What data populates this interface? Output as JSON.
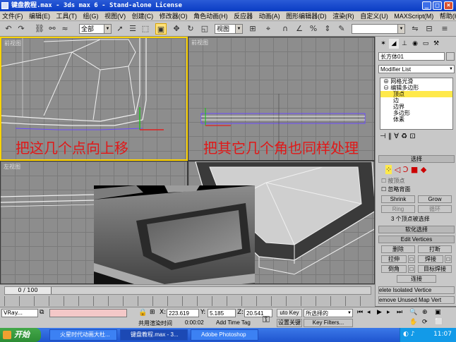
{
  "window": {
    "title": "键盘教程.max - 3ds max 6 - Stand-alone License"
  },
  "menu": [
    "文件(F)",
    "编辑(E)",
    "工具(T)",
    "组(G)",
    "视图(V)",
    "创建(C)",
    "修改器(O)",
    "角色动画(H)",
    "反应器",
    "动画(A)",
    "图形编辑器(D)",
    "渲染(R)",
    "自定义(U)",
    "MAXScript(M)",
    "帮助(H)"
  ],
  "toolbar": {
    "selection_filter": "全部",
    "ref_coord": "视图"
  },
  "viewports": {
    "top_left": {
      "label": "前视图"
    },
    "top_right": {
      "label": "前视图"
    },
    "bottom_left": {
      "label": "左视图"
    },
    "annotation_left": "把这几个点向上移",
    "annotation_right": "把其它几个角也同样处理"
  },
  "cmdpanel": {
    "object_name": "长方体01",
    "modifier_list": "Modifier List",
    "stack": [
      "网格光滑",
      "编辑多边形",
      "顶点",
      "边",
      "边界",
      "多边形",
      "体素"
    ],
    "selected_stack_index": 2,
    "select_rollout": "选择",
    "by_vertex": "按顶点",
    "ignore_backfacing": "忽略背面",
    "shrink": "Shrink",
    "grow": "Grow",
    "ring": "Ring",
    "loop": "循环",
    "selection_info": "3 个顶点被选择",
    "soft_selection": "软化选择",
    "edit_vertices": "Edit Vertices",
    "remove": "删除",
    "break": "打断",
    "extrude": "拉伸",
    "weld": "焊接",
    "chamfer": "倒角",
    "target_weld": "目标焊接",
    "connect": "连接",
    "remove_isolated": "elete Isolated Vertice",
    "remove_unused": "emove Unused Map Vert"
  },
  "timeline": {
    "frame_display": "0 / 100"
  },
  "status": {
    "x_label": "X:",
    "x": "223.619",
    "y_label": "Y:",
    "y": "5.185",
    "z_label": "Z:",
    "z": "20.541",
    "auto_key": "uto Key",
    "auto_key_filter": "所选择的",
    "set_key": "设置关键",
    "key_filters": "Key Filters...",
    "prompt": "共用渲染时间",
    "time": "0:00:02",
    "add_time_tag": "Add Time Tag",
    "vray": "VRay..."
  },
  "taskbar": {
    "start": "开始",
    "tasks": [
      "火星时代动画大杜...",
      "键盘教程.max - 3...",
      "Adobe Photoshop"
    ],
    "clock": "11:07"
  }
}
